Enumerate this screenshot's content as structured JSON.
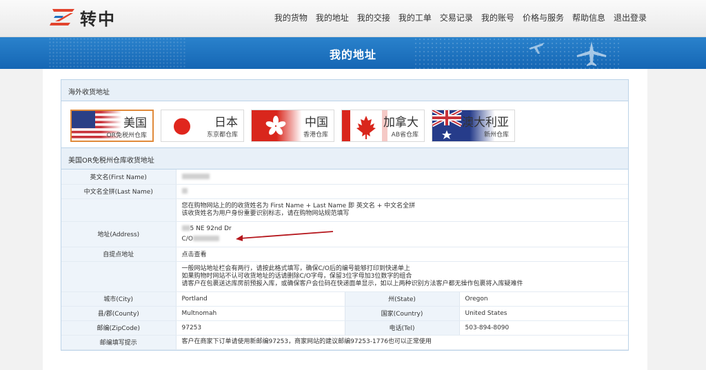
{
  "brand": {
    "name": "转中"
  },
  "nav": [
    "我的货物",
    "我的地址",
    "我的交接",
    "我的工单",
    "交易记录",
    "我的账号",
    "价格与服务",
    "帮助信息",
    "退出登录"
  ],
  "banner": {
    "title": "我的地址"
  },
  "overseas": {
    "title": "海外收货地址"
  },
  "warehouses": [
    {
      "name": "美国",
      "sub": "OR免税州仓库",
      "active": true
    },
    {
      "name": "日本",
      "sub": "东京都仓库",
      "active": false
    },
    {
      "name": "中国",
      "sub": "香港仓库",
      "active": false
    },
    {
      "name": "加拿大",
      "sub": "AB省仓库",
      "active": false
    },
    {
      "name": "澳大利亚",
      "sub": "新州仓库",
      "active": false
    }
  ],
  "address": {
    "title": "美国OR免税州仓库收货地址",
    "first_name_label": "英文名(First Name)",
    "last_name_label": "中文名全拼(Last Name)",
    "name_note_1": "您在购物网站上的的收货姓名为 First Name + Last Name 即 英文名 + 中文名全拼",
    "name_note_2": "该收货姓名为用户身份重要识别标志，请在购物网站规范填写",
    "address_label": "地址(Address)",
    "address_line1_tail": "5 NE 92nd Dr",
    "address_line2_prefix": "C/O",
    "pickup_label": "自提点地址",
    "pickup_link": "点击查看",
    "addr_note_1": "一般网站地址栏会有两行，请按此格式填写，确保C/O后的编号能够打印到快递单上",
    "addr_note_2": "如果购物时网站不认可收货地址的话请删除C/O字母，保留3位字母加3位数字的组合",
    "addr_note_3": "请客户在包裹送达库房前预报入库，或确保客户会位码在快递面单显示，如以上两种识别方法客户都无操作包裹将入库疑难件",
    "city_label": "城市(City)",
    "city": "Portland",
    "state_label": "州(State)",
    "state": "Oregon",
    "county_label": "县/郡(County)",
    "county": "Multnomah",
    "country_label": "国家(Country)",
    "country": "United States",
    "zip_label": "邮编(ZipCode)",
    "zip": "97253",
    "tel_label": "电话(Tel)",
    "tel": "503-894-8090",
    "zip_tip_label": "邮编填写提示",
    "zip_tip": "客户在商家下订单请使用新邮编97253，商家网站的建议邮编97253-1776也可以正常使用"
  },
  "colors": {
    "banner": "#1e74c2",
    "note": "#d0461f",
    "active_border": "#e08a3a"
  }
}
